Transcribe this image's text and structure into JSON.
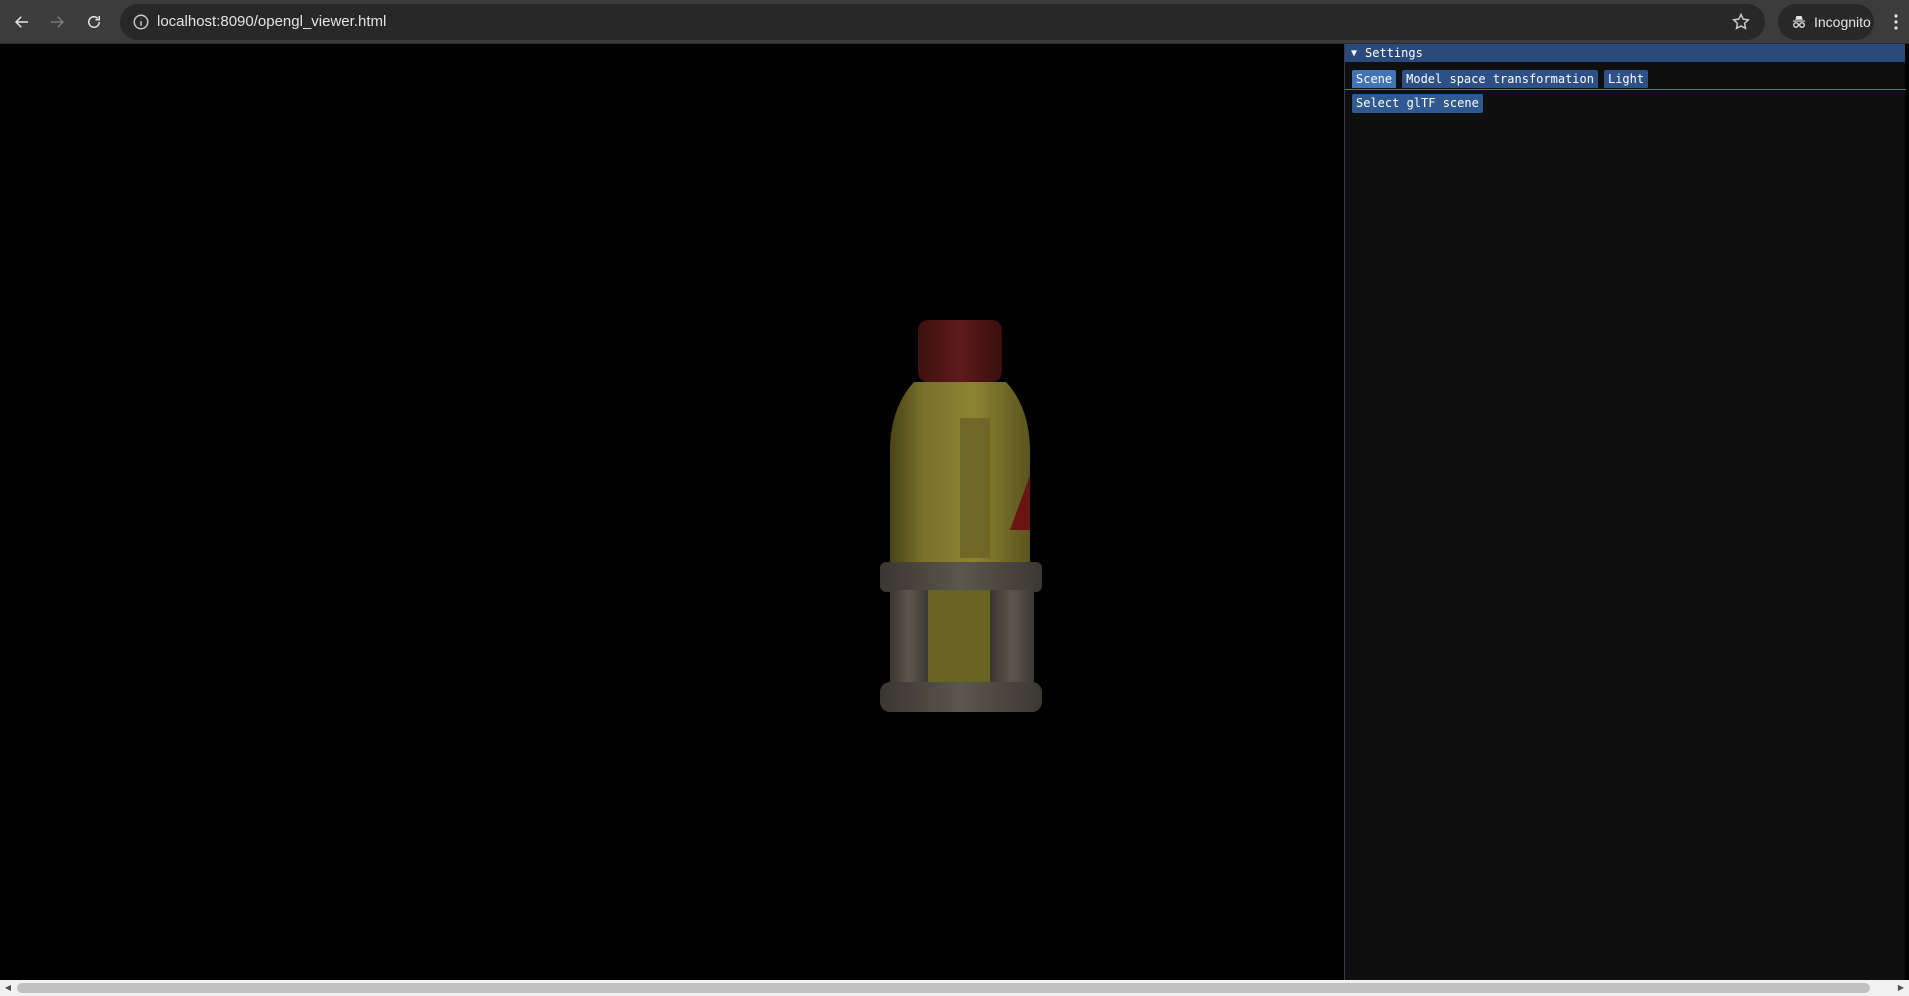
{
  "browser": {
    "url": "localhost:8090/opengl_viewer.html",
    "profile_label": "Incognito",
    "icons": {
      "back": "back-arrow-icon",
      "forward": "forward-arrow-icon",
      "reload": "reload-icon",
      "site_info": "info-icon",
      "bookmark": "star-icon",
      "incognito": "incognito-icon",
      "menu": "kebab-menu-icon"
    }
  },
  "viewer": {
    "model": "glTF bottle model"
  },
  "settings": {
    "title": "Settings",
    "tabs": [
      {
        "label": "Scene",
        "active": true
      },
      {
        "label": "Model space transformation",
        "active": false
      },
      {
        "label": "Light",
        "active": false
      }
    ],
    "select_scene_button": "Select glTF scene"
  },
  "colors": {
    "imgui_title_bg": "#294a7a",
    "imgui_tab": "#2e5088",
    "imgui_tab_active": "#4272b8",
    "panel_bg": "#0f0f0f",
    "chrome_bg": "#3c3c3c"
  }
}
